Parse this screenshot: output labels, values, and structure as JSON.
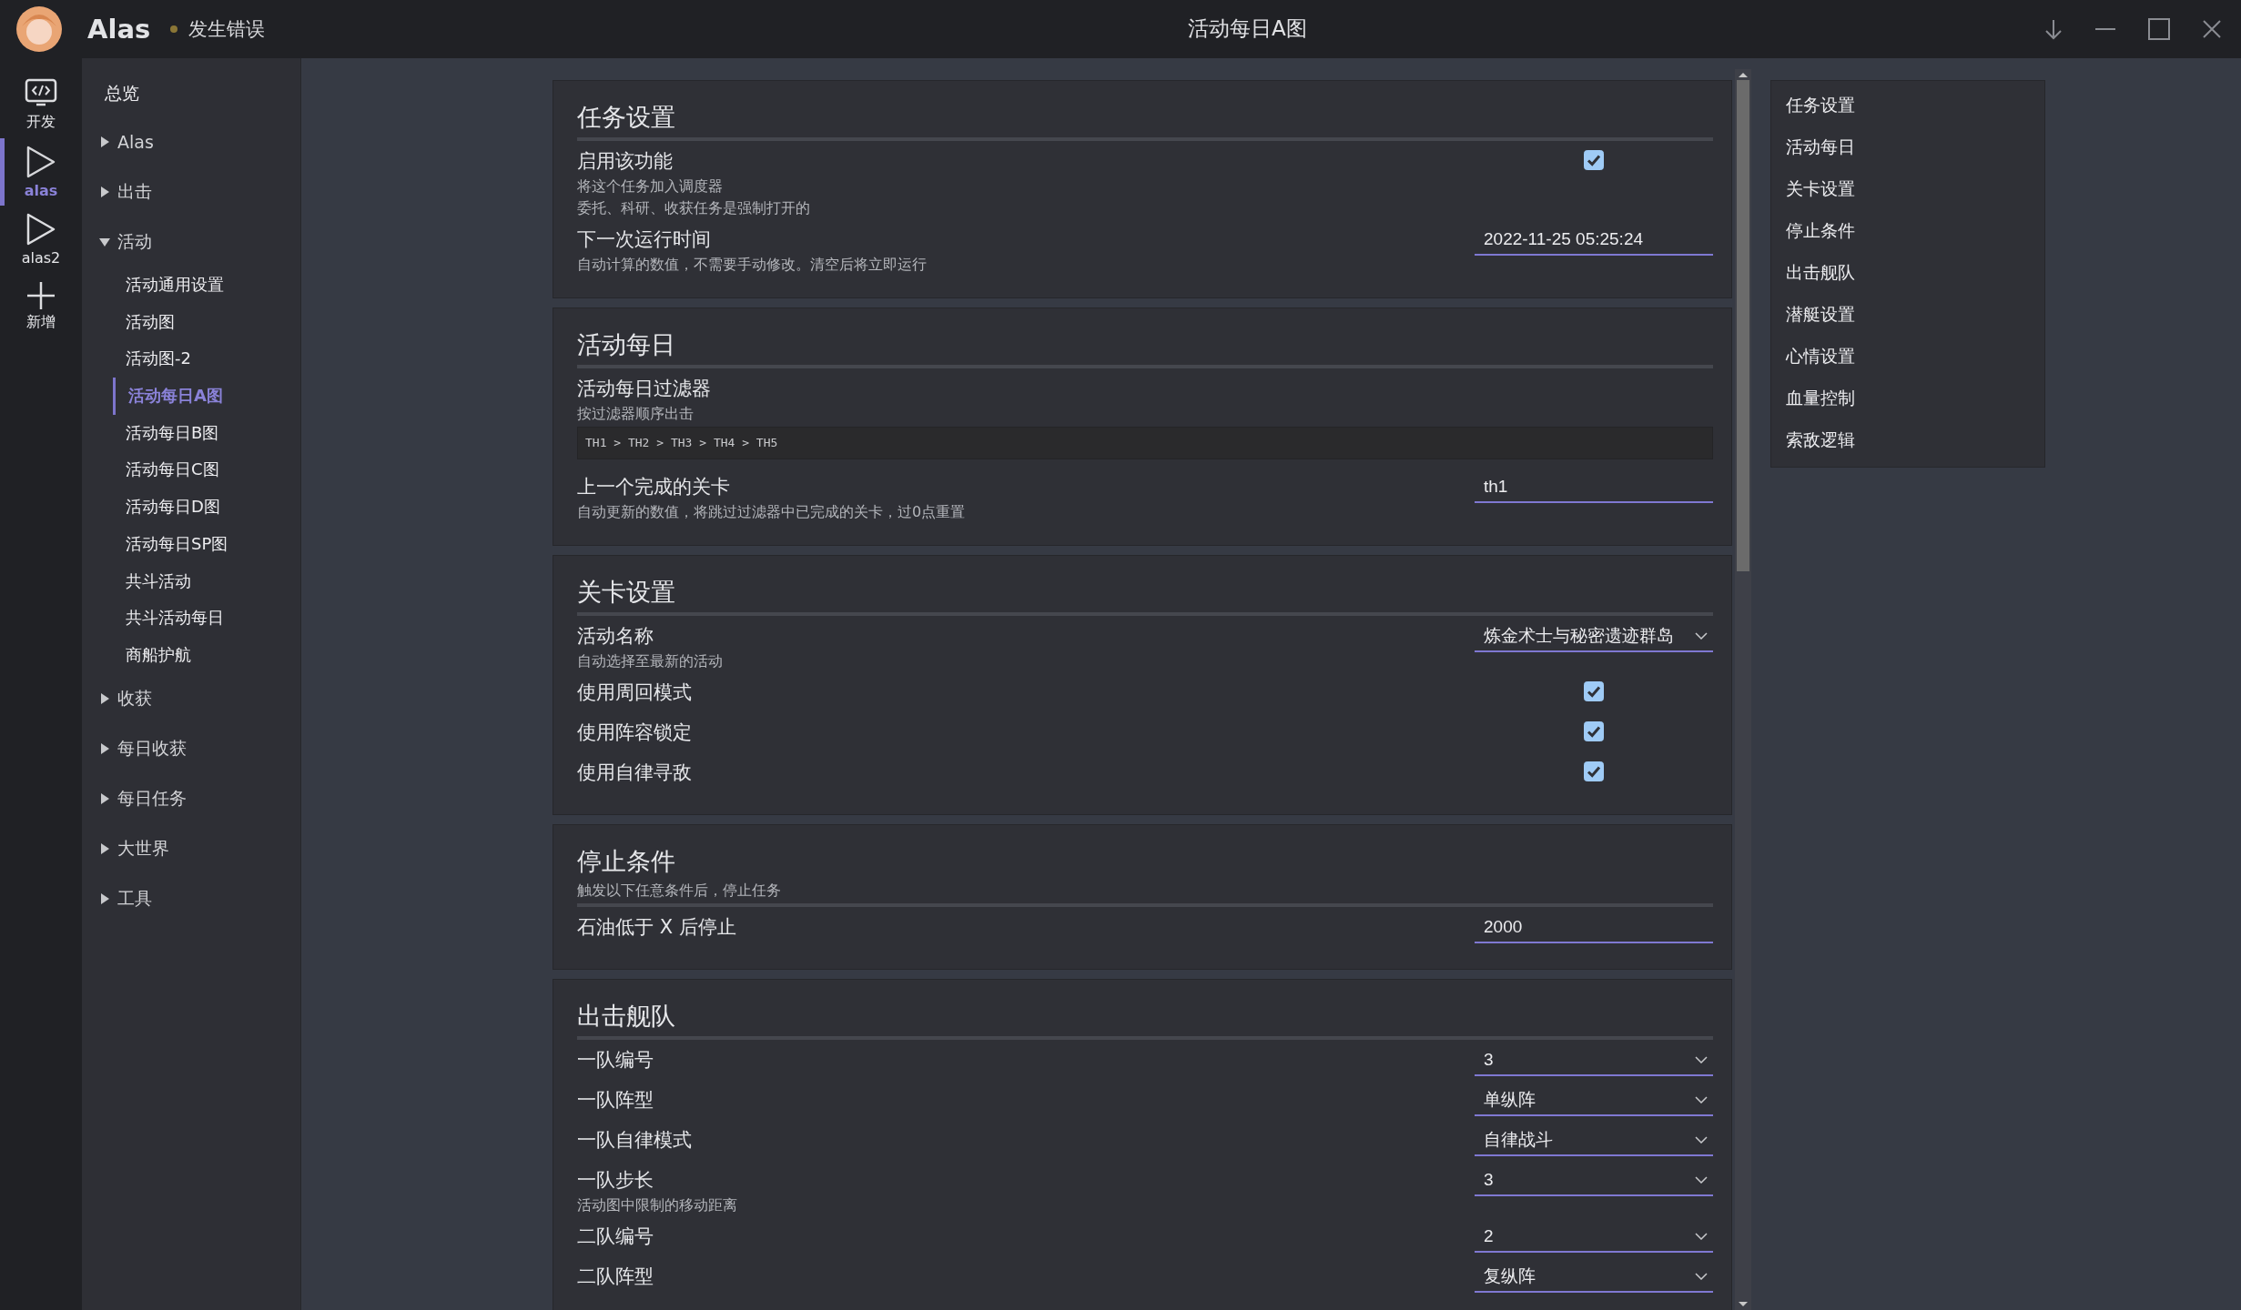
{
  "titlebar": {
    "app_name": "Alas",
    "status": "发生错误",
    "title": "活动每日A图"
  },
  "instances": [
    {
      "label": "开发",
      "kind": "code",
      "selected": false
    },
    {
      "label": "alas",
      "kind": "play",
      "selected": true
    },
    {
      "label": "alas2",
      "kind": "play",
      "selected": false
    },
    {
      "label": "新增",
      "kind": "add",
      "selected": false
    }
  ],
  "nav": [
    {
      "label": "总览",
      "kind": "leaf"
    },
    {
      "label": "Alas",
      "kind": "group",
      "expanded": false
    },
    {
      "label": "出击",
      "kind": "group",
      "expanded": false
    },
    {
      "label": "活动",
      "kind": "group",
      "expanded": true,
      "children": [
        {
          "label": "活动通用设置",
          "selected": false
        },
        {
          "label": "活动图",
          "selected": false
        },
        {
          "label": "活动图-2",
          "selected": false
        },
        {
          "label": "活动每日A图",
          "selected": true
        },
        {
          "label": "活动每日B图",
          "selected": false
        },
        {
          "label": "活动每日C图",
          "selected": false
        },
        {
          "label": "活动每日D图",
          "selected": false
        },
        {
          "label": "活动每日SP图",
          "selected": false
        },
        {
          "label": "共斗活动",
          "selected": false
        },
        {
          "label": "共斗活动每日",
          "selected": false
        },
        {
          "label": "商船护航",
          "selected": false
        }
      ]
    },
    {
      "label": "收获",
      "kind": "group",
      "expanded": false
    },
    {
      "label": "每日收获",
      "kind": "group",
      "expanded": false
    },
    {
      "label": "每日任务",
      "kind": "group",
      "expanded": false
    },
    {
      "label": "大世界",
      "kind": "group",
      "expanded": false
    },
    {
      "label": "工具",
      "kind": "group",
      "expanded": false
    }
  ],
  "sections": [
    {
      "title": "任务设置",
      "rows": [
        {
          "kind": "checkbox",
          "label": "启用该功能",
          "help": [
            "将这个任务加入调度器",
            "委托、科研、收获任务是强制打开的"
          ],
          "checked": true
        },
        {
          "kind": "input",
          "label": "下一次运行时间",
          "help": [
            "自动计算的数值，不需要手动修改。清空后将立即运行"
          ],
          "value": "2022-11-25 05:25:24"
        }
      ]
    },
    {
      "title": "活动每日",
      "rows": [
        {
          "kind": "filter",
          "label": "活动每日过滤器",
          "help": [
            "按过滤器顺序出击"
          ],
          "value": "TH1 > TH2 > TH3 > TH4 > TH5"
        },
        {
          "kind": "input",
          "label": "上一个完成的关卡",
          "help": [
            "自动更新的数值，将跳过过滤器中已完成的关卡，过0点重置"
          ],
          "value": "th1"
        }
      ]
    },
    {
      "title": "关卡设置",
      "rows": [
        {
          "kind": "select",
          "label": "活动名称",
          "help": [
            "自动选择至最新的活动"
          ],
          "value": "炼金术士与秘密遗迹群岛"
        },
        {
          "kind": "checkbox",
          "label": "使用周回模式",
          "checked": true
        },
        {
          "kind": "checkbox",
          "label": "使用阵容锁定",
          "checked": true
        },
        {
          "kind": "checkbox",
          "label": "使用自律寻敌",
          "checked": true
        }
      ]
    },
    {
      "title": "停止条件",
      "description": "触发以下任意条件后，停止任务",
      "rows": [
        {
          "kind": "input",
          "label": "石油低于 X 后停止",
          "value": "2000"
        }
      ]
    },
    {
      "title": "出击舰队",
      "rows": [
        {
          "kind": "select",
          "label": "一队编号",
          "value": "3"
        },
        {
          "kind": "select",
          "label": "一队阵型",
          "value": "单纵阵"
        },
        {
          "kind": "select",
          "label": "一队自律模式",
          "value": "自律战斗"
        },
        {
          "kind": "select",
          "label": "一队步长",
          "help": [
            "活动图中限制的移动距离"
          ],
          "value": "3"
        },
        {
          "kind": "select",
          "label": "二队编号",
          "value": "2"
        },
        {
          "kind": "select",
          "label": "二队阵型",
          "value": "复纵阵"
        }
      ]
    }
  ],
  "outline": [
    "任务设置",
    "活动每日",
    "关卡设置",
    "停止条件",
    "出击舰队",
    "潜艇设置",
    "心情设置",
    "血量控制",
    "索敌逻辑"
  ]
}
